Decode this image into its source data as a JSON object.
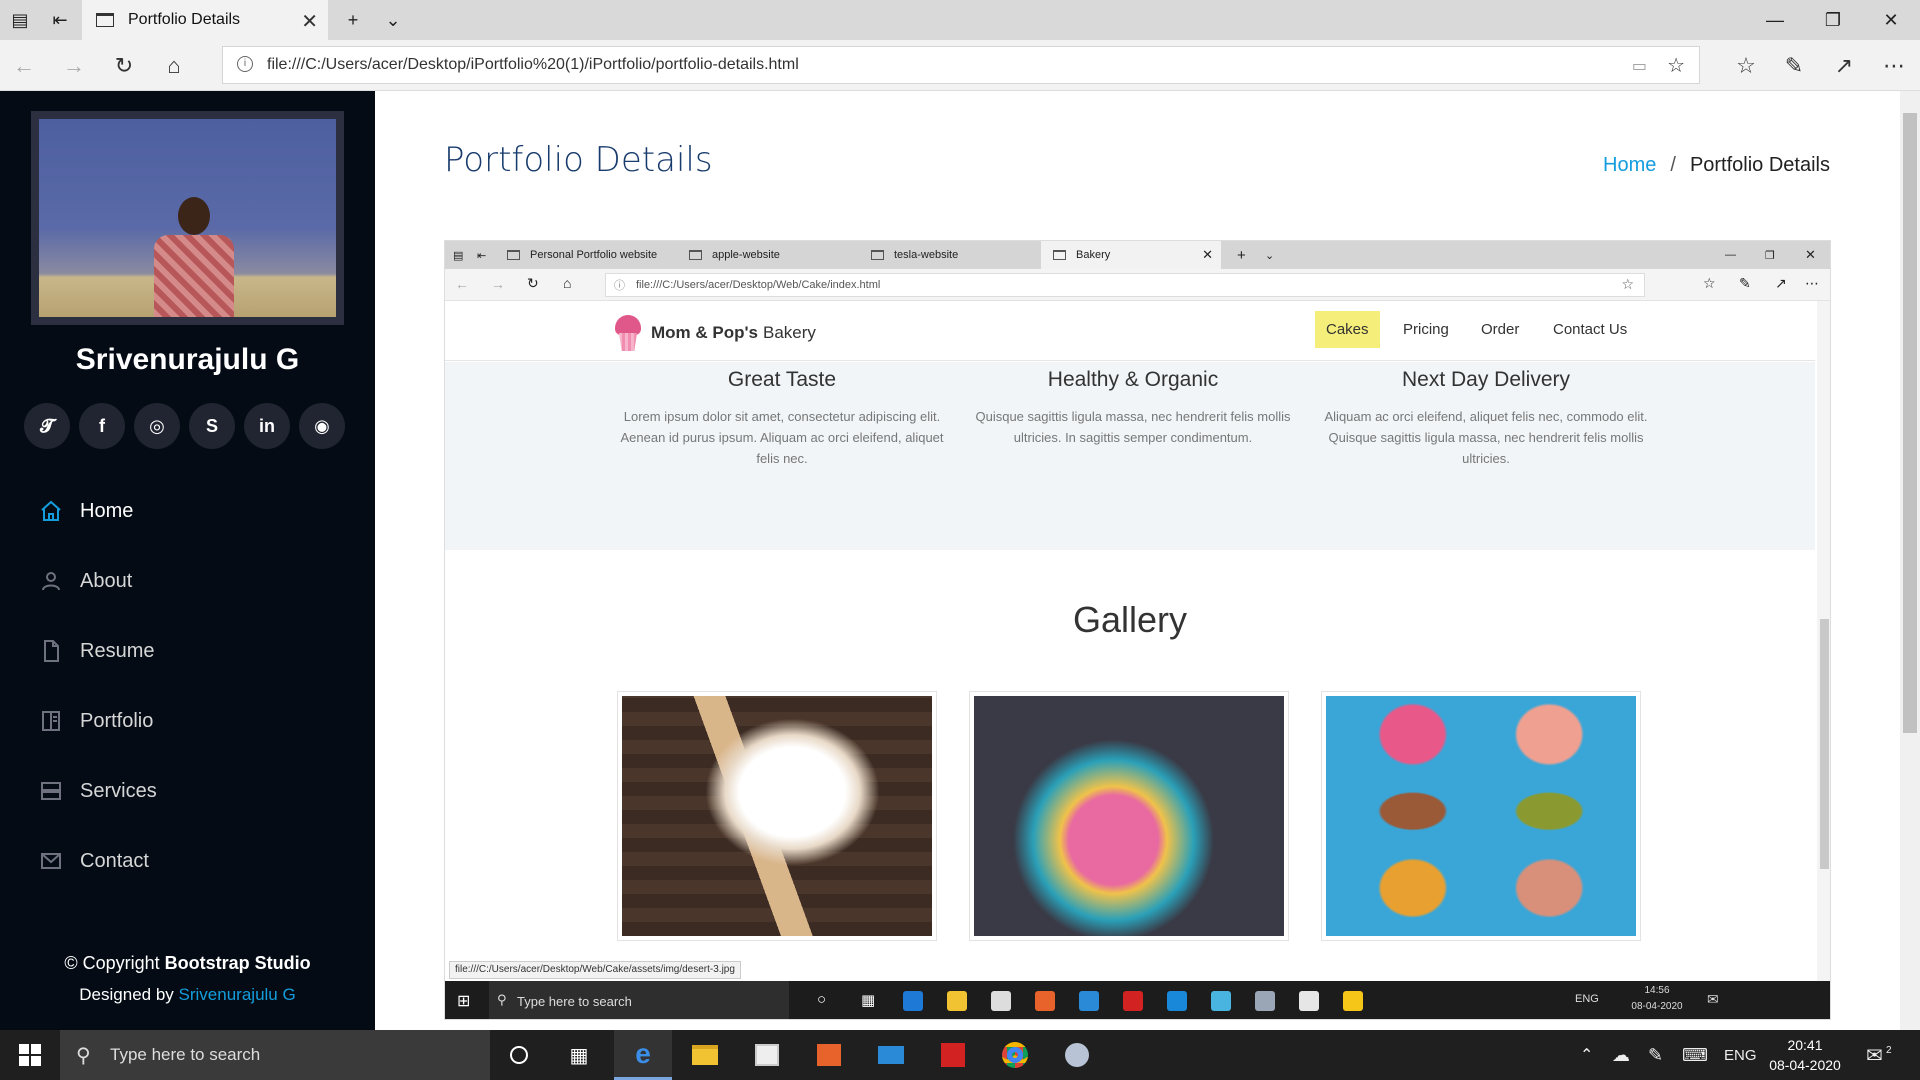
{
  "browser": {
    "tab_title": "Portfolio Details",
    "url": "file:///C:/Users/acer/Desktop/iPortfolio%20(1)/iPortfolio/portfolio-details.html"
  },
  "sidebar": {
    "name": "Srivenurajulu G",
    "socials": [
      "twitter-icon",
      "facebook-icon",
      "instagram-icon",
      "skype-icon",
      "linkedin-icon",
      "github-icon"
    ],
    "nav": [
      {
        "label": "Home",
        "icon": "home-icon"
      },
      {
        "label": "About",
        "icon": "person-icon"
      },
      {
        "label": "Resume",
        "icon": "file-icon"
      },
      {
        "label": "Portfolio",
        "icon": "book-icon"
      },
      {
        "label": "Services",
        "icon": "server-icon"
      },
      {
        "label": "Contact",
        "icon": "envelope-icon"
      }
    ],
    "copyright_prefix": "© Copyright",
    "copyright_brand": "Bootstrap Studio",
    "designed_prefix": "Designed by",
    "designed_name": "Srivenurajulu G"
  },
  "main": {
    "title": "Portfolio Details",
    "breadcrumb_home": "Home",
    "breadcrumb_sep": "/",
    "breadcrumb_current": "Portfolio Details"
  },
  "embed": {
    "tabs": [
      "Personal Portfolio website",
      "apple-website",
      "tesla-website",
      "Bakery"
    ],
    "url": "file:///C:/Users/acer/Desktop/Web/Cake/index.html",
    "brand_bold": "Mom & Pop's",
    "brand_rest": "Bakery",
    "nav": [
      "Cakes",
      "Pricing",
      "Order",
      "Contact Us"
    ],
    "features": [
      {
        "title": "Great Taste",
        "text": "Lorem ipsum dolor sit amet, consectetur adipiscing elit. Aenean id purus ipsum. Aliquam ac orci eleifend, aliquet felis nec."
      },
      {
        "title": "Healthy & Organic",
        "text": "Quisque sagittis ligula massa, nec hendrerit felis mollis ultricies. In sagittis semper condimentum."
      },
      {
        "title": "Next Day Delivery",
        "text": "Aliquam ac orci eleifend, aliquet felis nec, commodo elit. Quisque sagittis ligula massa, nec hendrerit felis mollis ultricies."
      }
    ],
    "gallery_title": "Gallery",
    "status_url": "file:///C:/Users/acer/Desktop/Web/Cake/assets/img/desert-3.jpg",
    "taskbar_search": "Type here to search",
    "tray_lang": "ENG",
    "time": "14:56",
    "date": "08-04-2020"
  },
  "taskbar": {
    "search_placeholder": "Type here to search",
    "lang": "ENG",
    "time": "20:41",
    "date": "08-04-2020",
    "notifications": "2"
  },
  "colors": {
    "accent": "#149ddd",
    "sidebar_bg": "#040b14",
    "highlight": "#f5ee7a"
  }
}
